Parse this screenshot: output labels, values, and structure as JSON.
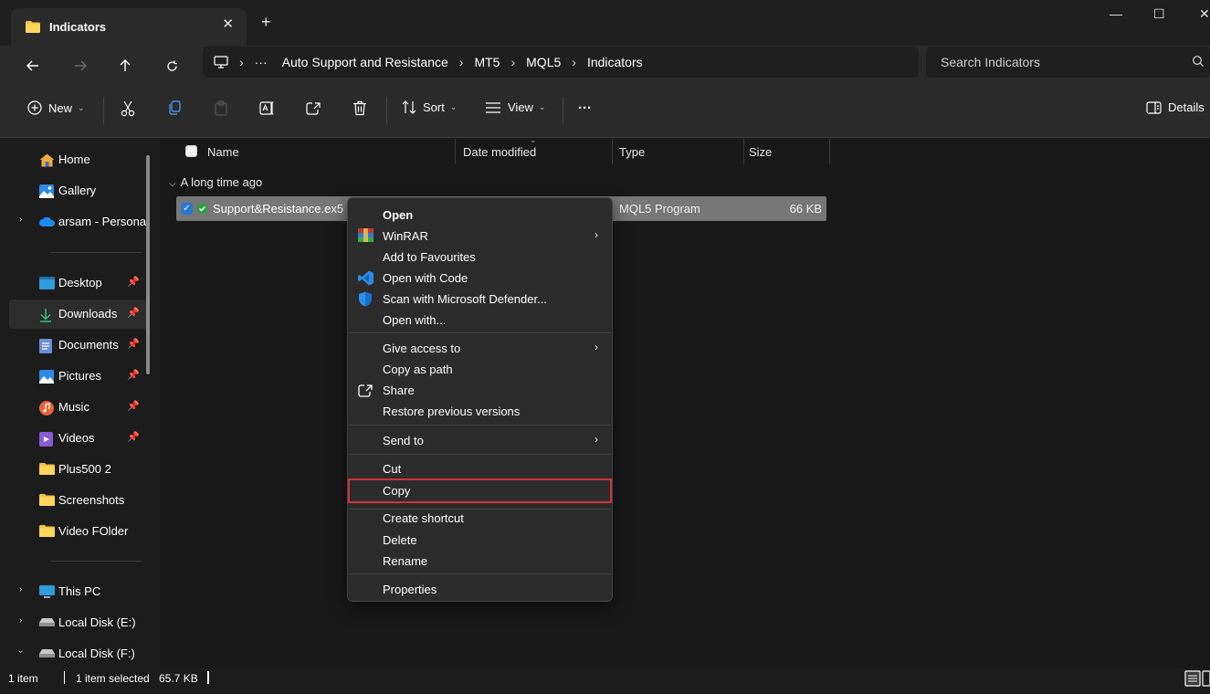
{
  "window": {
    "tab_title": "Indicators",
    "tab_close": "✕",
    "new_tab": "+",
    "controls": {
      "minimize": "—",
      "maximize": "☐",
      "close": "✕"
    }
  },
  "address": {
    "overflow": "···",
    "breadcrumb": [
      "Auto Support and Resistance",
      "MT5",
      "MQL5",
      "Indicators"
    ],
    "search_placeholder": "Search Indicators"
  },
  "commandbar": {
    "new_label": "New",
    "sort_label": "Sort",
    "view_label": "View",
    "more_label": "···",
    "details_label": "Details"
  },
  "sidebar": {
    "items": [
      {
        "label": "Home",
        "icon": "home-icon"
      },
      {
        "label": "Gallery",
        "icon": "gallery-icon"
      },
      {
        "label": "arsam - Persona",
        "icon": "onedrive-icon"
      },
      {
        "label": "Desktop",
        "icon": "desktop-icon",
        "pinned": true
      },
      {
        "label": "Downloads",
        "icon": "downloads-icon",
        "pinned": true,
        "selected": true
      },
      {
        "label": "Documents",
        "icon": "documents-icon",
        "pinned": true
      },
      {
        "label": "Pictures",
        "icon": "pictures-icon",
        "pinned": true
      },
      {
        "label": "Music",
        "icon": "music-icon",
        "pinned": true
      },
      {
        "label": "Videos",
        "icon": "videos-icon",
        "pinned": true
      },
      {
        "label": "Plus500 2",
        "icon": "folder-icon"
      },
      {
        "label": "Screenshots",
        "icon": "folder-icon"
      },
      {
        "label": "Video FOlder",
        "icon": "folder-icon"
      },
      {
        "label": "This PC",
        "icon": "pc-icon"
      },
      {
        "label": "Local Disk (E:)",
        "icon": "drive-icon"
      },
      {
        "label": "Local Disk (F:)",
        "icon": "drive-icon"
      }
    ]
  },
  "content": {
    "columns": {
      "name": "Name",
      "date_modified": "Date modified",
      "type": "Type",
      "size": "Size"
    },
    "group_header": "A long time ago",
    "file": {
      "name": "Support&Resistance.ex5",
      "type": "MQL5 Program",
      "size": "66 KB"
    }
  },
  "context_menu": {
    "open": "Open",
    "winrar": "WinRAR",
    "add_favourites": "Add to Favourites",
    "open_with_code": "Open with Code",
    "scan_defender": "Scan with Microsoft Defender...",
    "open_with": "Open with...",
    "give_access": "Give access to",
    "copy_as_path": "Copy as path",
    "share": "Share",
    "restore_versions": "Restore previous versions",
    "send_to": "Send to",
    "cut": "Cut",
    "copy": "Copy",
    "create_shortcut": "Create shortcut",
    "delete": "Delete",
    "rename": "Rename",
    "properties": "Properties"
  },
  "statusbar": {
    "item_count": "1 item",
    "selected": "1 item selected",
    "size": "65.7 KB"
  },
  "colors": {
    "accent": "#2a78d4",
    "highlight_border": "#d13438",
    "selection": "#777777"
  }
}
